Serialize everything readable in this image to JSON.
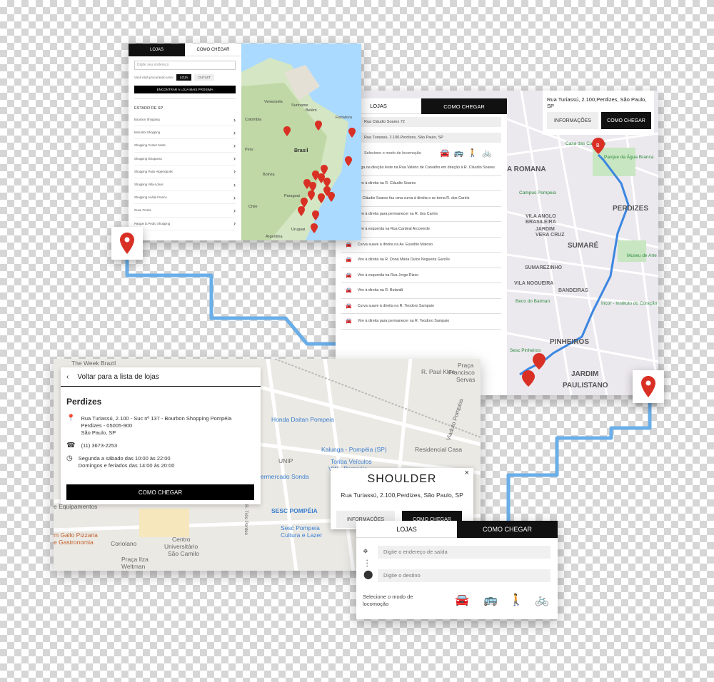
{
  "colors": {
    "route": "#6aaee8",
    "pin": "#d93025",
    "dark": "#111111"
  },
  "search_panel": {
    "tab_lojas": "LOJAS",
    "tab_como_chegar": "COMO CHEGAR",
    "address_placeholder": "Digite seu endereço",
    "near_label": "Você está procurando uma:",
    "chip_loja": "LOJA",
    "chip_outlet": "OUTLET",
    "find_button": "ENCONTRAR A LOJA MAIS PRÓXIMA",
    "state_title": "ESTADO DE SP",
    "malls": [
      "Bourbon Shopping",
      "Morumbi Shopping",
      "Shopping Center Norte",
      "Shopping Ibirapuera",
      "Shopping Patio Higienópolis",
      "Shopping Villa-Lobos",
      "Shopping Anália Franco",
      "Ouse Frente",
      "Parque D.Pedro Shopping"
    ],
    "map_labels": {
      "venezuela": "Venezuela",
      "colombia": "Colombia",
      "brasil": "Brasil",
      "bolivia": "Bolívia",
      "paraguai": "Paraguai",
      "chile": "Chile",
      "argentina": "Argentina",
      "peru": "Peru",
      "uruguai": "Uruguai",
      "suriname": "Suriname",
      "belem": "Belém",
      "fortaleza": "Fortaleza"
    }
  },
  "directions_panel": {
    "tab_lojas": "LOJAS",
    "tab_como_chegar": "COMO CHEGAR",
    "origin": "Rua Cláudio Soares 72",
    "destination": "Rua Turiassú, 2.100,Perdizes, São Paulo, SP",
    "mode_label": "Selecione o modo de locomoção",
    "steps": [
      "Siga na direção leste na Rua Valério de Carvalho em direção à R. Cláudio Soares",
      "Vire à direita na R. Cláudio Soares",
      "R. Cláudio Soares faz uma curva à direita e se torna R. dos Cariris",
      "Vire à direita para permanecer na R. dos Cariris",
      "Vire à esquerda na Rua Cardeal Arcoverde",
      "Curva suave à direita na Av. Eusébio Matoso",
      "Vire à direita na R. Doná Maria Dulce Nogueira Garcês",
      "Vire à esquerda na Rua Jorge Rizzo",
      "Vire à direita na R. Butantã",
      "Curva suave à direita na R. Teodoro Sampaio",
      "Vire à direita para permanecer na R. Teodoro Sampaio"
    ],
    "address_card": {
      "address": "Rua Turiassú, 2.100,Perdizes, São Paulo, SP",
      "info_button": "INFORMAÇÕES",
      "directions_button": "COMO CHEGAR"
    },
    "map_labels": {
      "romana": "A ROMANA",
      "perdizes": "PERDIZES",
      "sumare": "SUMARÉ",
      "sumarezinho": "SUMAREZINHO",
      "pinheiros": "PINHEIROS",
      "jardim": "JARDIM",
      "paulistano": "PAULISTANO",
      "vila_anglo": "VILA ANGLO",
      "brasileira": "BRASILEIRA",
      "jardim_vera": "JARDIM",
      "vera_cruz": "VERA CRUZ",
      "vila_nogueira": "VILA NOGUEIRA",
      "bandeiras": "BANDEIRAS",
      "casa": "Casa das Caldeiras",
      "parque": "Parque da Água Branca",
      "campus": "Campus Pompeia",
      "beco": "Beco do Batman",
      "museu": "Museu de Arte",
      "incor": "Incor - Instituto do Coração",
      "sesc": "Sesc Pinheiros"
    }
  },
  "store_panel": {
    "back_label": "Voltar para a lista de lojas",
    "store_name": "Perdizes",
    "address_line1": "Rua Turiassú, 2.100 - Suc nº 137 - Bourbon Shopping Pompéia",
    "address_line2": "Perdizes - 05005-900",
    "address_line3": "São Paulo, SP",
    "phone": "(11) 3673-2253",
    "hours_line1": "Segunda a sábado das 10:00 às 22:00",
    "hours_line2": "Domingos e feriados das 14:00 às 20:00",
    "cta": "COMO CHEGAR",
    "map_labels": {
      "week": "The Week Brazil",
      "paul_klee": "R. Paul Klee",
      "praca": "Praça",
      "francisco": "Francisco",
      "servas": "Servas",
      "honda": "Honda Daitan Pompeia",
      "kalunga": "Kalunga - Pompéia (SP)",
      "unip": "UNIP",
      "toriba": "Toriba Veículos",
      "vw": "VW - Pompéia",
      "residencial": "Residencial Casa",
      "sonda": "ermercado Sonda",
      "sesc": "SESC POMPÉIA",
      "sesc2": "Sesc Pompeia",
      "cultura": "Cultura e Lazer",
      "gallo": "m Gallo Pizzaria",
      "gastronomia": "e Gastronomia",
      "coriolano": "Coriolano",
      "centro": "Centro",
      "universitario": "Universitário",
      "camilo": "São Camilo",
      "ilza": "Praça Ilza",
      "weltman": "Weltman",
      "viaduto": "Viaduto Pompéia",
      "equip": "e Equipamentos",
      "tres": "R. Três Pontes"
    }
  },
  "shoulder_popup": {
    "brand": "SHOULDER",
    "address": "Rua Turiassú, 2.100,Perdizes, São Paulo, SP",
    "info_button": "INFORMAÇÕES",
    "directions_button": "COMO CHEGAR",
    "close": "×"
  },
  "route_panel": {
    "tab_lojas": "LOJAS",
    "tab_como_chegar": "COMO CHEGAR",
    "origin_placeholder": "Digite o endereço de saída",
    "dest_placeholder": "Digite o destino",
    "mode_label_1": "Selecione o modo de",
    "mode_label_2": "locomoção",
    "modes": [
      "car-icon",
      "bus-icon",
      "walk-icon",
      "bike-icon"
    ]
  }
}
